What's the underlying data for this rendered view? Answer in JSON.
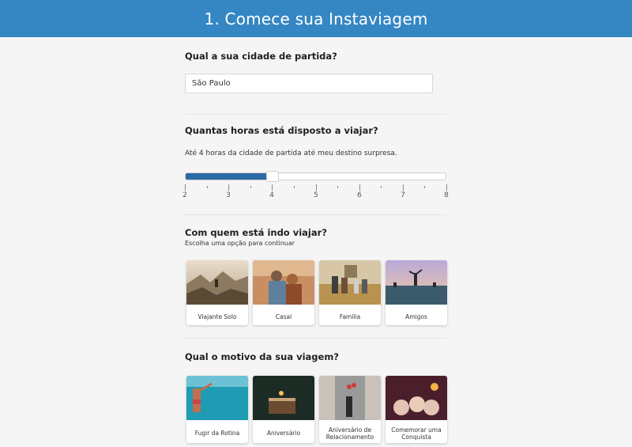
{
  "header": {
    "title": "1. Comece sua Instaviagem"
  },
  "departure": {
    "question": "Qual a sua cidade de partida?",
    "value": "São Paulo"
  },
  "hours": {
    "question": "Quantas horas está disposto a viajar?",
    "description": "Até 4 horas da cidade de partida até meu destino surpresa.",
    "slider": {
      "min": 2,
      "max": 8,
      "value": 4,
      "ticks": [
        "2",
        "3",
        "4",
        "5",
        "6",
        "7",
        "8"
      ]
    },
    "fill_color": "#2b6aa5"
  },
  "companions": {
    "question": "Com quem está indo viajar?",
    "hint": "Escolha uma opção para continuar",
    "options": [
      {
        "label": "Viajante Solo",
        "image": "mountain-hiker-photo"
      },
      {
        "label": "Casal",
        "image": "couple-photo"
      },
      {
        "label": "Família",
        "image": "family-photo"
      },
      {
        "label": "Amigos",
        "image": "friends-pool-photo"
      }
    ]
  },
  "motive": {
    "question": "Qual o motivo da sua viagem?",
    "options": [
      {
        "label": "Fugir da Rotina",
        "image": "swimmer-photo"
      },
      {
        "label": "Aniversário",
        "image": "birthday-cake-photo"
      },
      {
        "label": "Aniversário de Relacionamento",
        "image": "city-couple-photo"
      },
      {
        "label": "Comemorar uma Conquista",
        "image": "champagne-toast-photo"
      }
    ]
  },
  "colors": {
    "header": "#3587c4",
    "background": "#f5f5f5"
  }
}
